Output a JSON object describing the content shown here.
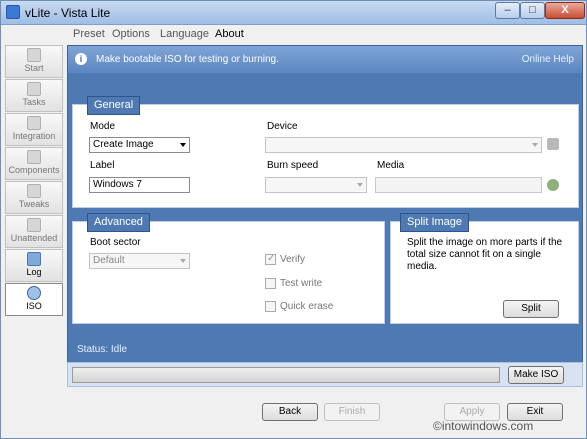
{
  "window": {
    "title": "vLite - Vista Lite",
    "controls": {
      "minimize": "–",
      "maximize": "□",
      "close": "X"
    }
  },
  "menu": {
    "items": [
      "Preset",
      "Options",
      "Language",
      "About"
    ]
  },
  "sidebar": {
    "items": [
      {
        "label": "Start",
        "icon": "start-icon"
      },
      {
        "label": "Tasks",
        "icon": "tasks-icon"
      },
      {
        "label": "Integration",
        "icon": "integration-icon"
      },
      {
        "label": "Components",
        "icon": "components-icon"
      },
      {
        "label": "Tweaks",
        "icon": "tweaks-icon"
      },
      {
        "label": "Unattended",
        "icon": "unattended-icon"
      },
      {
        "label": "Log",
        "icon": "log-icon"
      },
      {
        "label": "ISO",
        "icon": "iso-icon"
      }
    ]
  },
  "info_bar": {
    "text": "Make bootable ISO for testing or burning.",
    "help": "Online Help",
    "icon_glyph": "i"
  },
  "general": {
    "title": "General",
    "mode_label": "Mode",
    "mode_value": "Create Image",
    "device_label": "Device",
    "device_value": "",
    "label_label": "Label",
    "label_value": "Windows 7",
    "burn_speed_label": "Burn speed",
    "burn_speed_value": "",
    "media_label": "Media",
    "media_value": ""
  },
  "advanced": {
    "title": "Advanced",
    "boot_sector_label": "Boot sector",
    "boot_sector_value": "Default",
    "verify_label": "Verify",
    "test_write_label": "Test write",
    "quick_erase_label": "Quick erase"
  },
  "split": {
    "title": "Split Image",
    "description": "Split the image on more parts if the total size cannot fit on a single media.",
    "button": "Split"
  },
  "status": {
    "text": "Status: Idle"
  },
  "progress": {
    "value": 0,
    "make_iso_label": "Make ISO"
  },
  "footer": {
    "back": "Back",
    "finish": "Finish",
    "apply": "Apply",
    "exit": "Exit"
  },
  "watermark": "©intowindows.com",
  "colors": {
    "accent": "#4e79b2",
    "info_bar": "#6e98cf"
  }
}
